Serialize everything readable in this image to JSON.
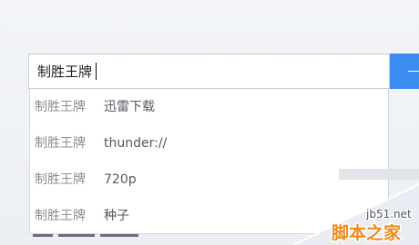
{
  "search": {
    "value": "制胜王牌"
  },
  "suggestions": [
    {
      "query": "制胜王牌",
      "extra": "迅雷下载"
    },
    {
      "query": "制胜王牌",
      "extra": "thunder://"
    },
    {
      "query": "制胜王牌",
      "extra": "720p"
    },
    {
      "query": "制胜王牌",
      "extra": "种子"
    }
  ],
  "watermark": {
    "site": "jb51.net",
    "brand": "脚本之家"
  },
  "colors": {
    "accent": "#3b8cf0",
    "watermark_orange": "#f08a1c"
  },
  "icons": {
    "search_button": "search-icon"
  }
}
